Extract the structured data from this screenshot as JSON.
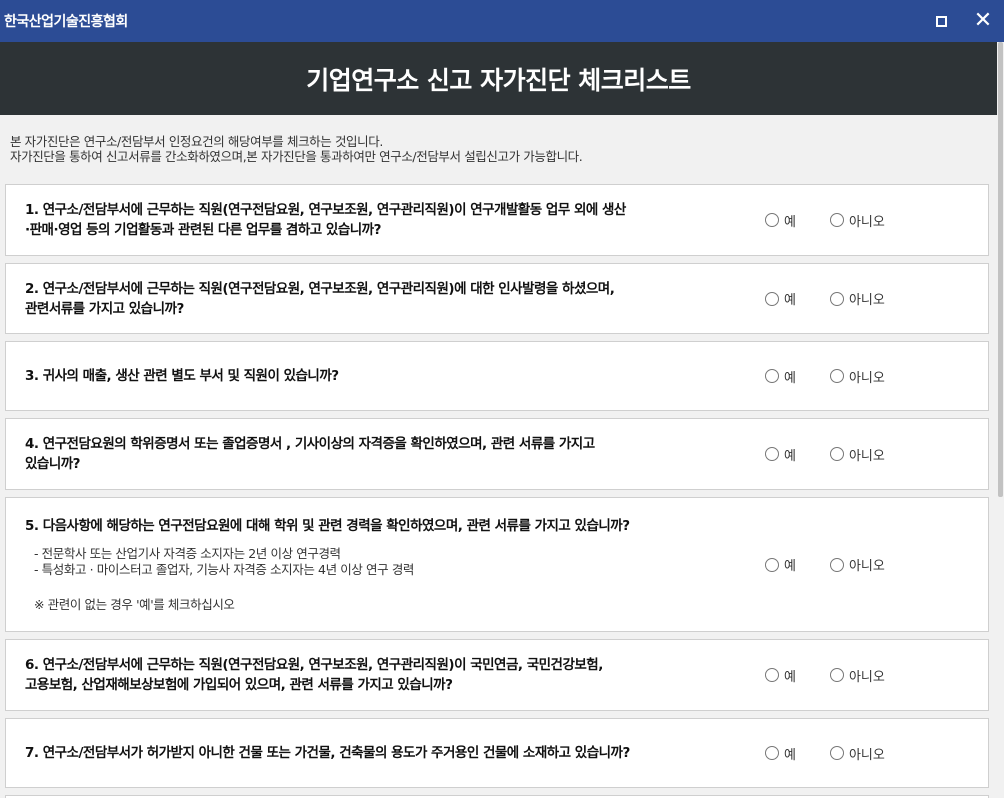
{
  "window": {
    "title": "한국산업기술진흥협회",
    "maximize_icon": "maximize-icon",
    "close_icon": "close-icon",
    "close_glyph": "✕"
  },
  "header": {
    "title": "기업연구소 신고 자가진단 체크리스트"
  },
  "intro": [
    "본 자가진단은 연구소/전담부서 인정요건의 해당여부를 체크하는 것입니다.",
    "자가진단을 통하여 신고서류를 간소화하였으며,본 자가진단을 통과하여만 연구소/전담부서 설립신고가 가능합니다."
  ],
  "options": {
    "yes": "예",
    "no": "아니오"
  },
  "questions": [
    {
      "lines": [
        "1. 연구소/전담부서에 근무하는 직원(연구전담요원, 연구보조원, 연구관리직원)이 연구개발활동 업무 외에 생산",
        "·판매·영업 등의 기업활동과 관련된 다른 업무를 겸하고 있습니까?"
      ]
    },
    {
      "lines": [
        "2. 연구소/전담부서에 근무하는 직원(연구전담요원, 연구보조원, 연구관리직원)에 대한 인사발령을 하셨으며,",
        "관련서류를 가지고 있습니까?"
      ]
    },
    {
      "lines": [
        "3. 귀사의 매출, 생산 관련 별도 부서 및 직원이 있습니까?"
      ]
    },
    {
      "lines": [
        "4. 연구전담요원의 학위증명서 또는 졸업증명서 , 기사이상의 자격증을 확인하였으며, 관련 서류를 가지고",
        "있습니까?"
      ]
    },
    {
      "lines": [
        "5. 다음사항에 해당하는 연구전담요원에 대해 학위 및 관련 경력을 확인하였으며, 관련 서류를 가지고 있습니까?"
      ],
      "sub": [
        "- 전문학사 또는 산업기사 자격증 소지자는 2년 이상 연구경력",
        "- 특성화고 · 마이스터고 졸업자, 기능사 자격증 소지자는 4년 이상 연구 경력"
      ],
      "note": "※ 관련이 없는 경우 '예'를 체크하십시오"
    },
    {
      "lines": [
        "6. 연구소/전담부서에 근무하는 직원(연구전담요원, 연구보조원, 연구관리직원)이 국민연금, 국민건강보험,",
        "고용보험, 산업재해보상보험에 가입되어 있으며, 관련 서류를 가지고 있습니까?"
      ]
    },
    {
      "lines": [
        "7. 연구소/전담부서가 허가받지 아니한 건물 또는 가건물, 건축물의 용도가 주거용인 건물에 소재하고 있습니까?"
      ]
    }
  ]
}
